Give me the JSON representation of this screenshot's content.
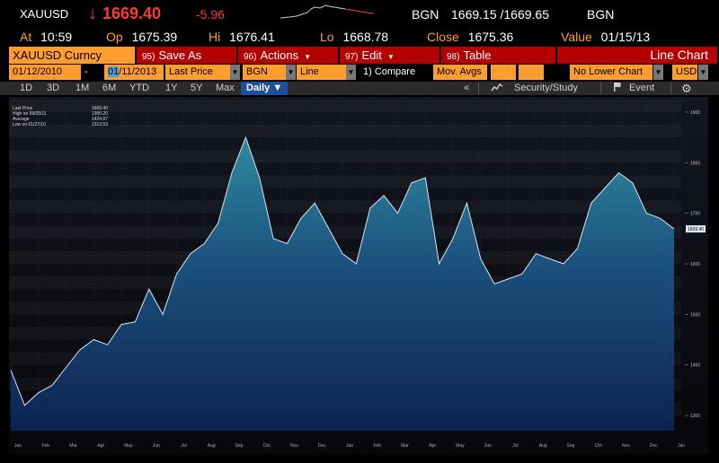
{
  "header": {
    "ticker": "XAUUSD",
    "arrow": "↓",
    "last": "1669.40",
    "change": "-5.96",
    "source": "BGN",
    "bid_ask": "1669.15 /1669.65",
    "source2": "BGN"
  },
  "stats": {
    "at_label": "At",
    "at_value": "10:59",
    "op_label": "Op",
    "op_value": "1675.39",
    "hi_label": "Hi",
    "hi_value": "1676.41",
    "lo_label": "Lo",
    "lo_value": "1668.78",
    "close_label": "Close",
    "close_value": "1675.36",
    "value_label": "Value",
    "value_value": "01/15/13"
  },
  "menu": {
    "security": "XAUUSD Curncy",
    "save_num": "95)",
    "save": "Save As",
    "actions_num": "96)",
    "actions": "Actions",
    "edit_num": "97)",
    "edit": "Edit",
    "table_num": "98)",
    "table": "Table",
    "chart_title": "Line Chart"
  },
  "params": {
    "start_date": "01/12/2010",
    "end_date_sel": "01",
    "end_date_rest": "/11/2013",
    "field": "Last Price",
    "source": "BGN",
    "style": "Line",
    "compare": "1) Compare",
    "mov_avgs": "Mov. Avgs",
    "lower_chart": "No Lower Chart",
    "currency": "USD"
  },
  "toolbar": {
    "periods": [
      "1D",
      "3D",
      "1M",
      "6M",
      "YTD",
      "1Y",
      "5Y",
      "Max"
    ],
    "frequency": "Daily",
    "collapse": "«",
    "security_study": "Security/Study",
    "event": "Event",
    "settings_icon": "gear-icon",
    "chart_icon": "chart-icon",
    "flag_icon": "flag-icon"
  },
  "legend": {
    "rows": [
      {
        "label": "Last Price",
        "value": "1669.40"
      },
      {
        "label": "High on 09/05/11",
        "value": "1900.20"
      },
      {
        "label": "Average",
        "value": "1424.87"
      },
      {
        "label": "Low on 01/27/10",
        "value": "1313.53"
      }
    ]
  },
  "colors": {
    "accent_orange": "#ff9d2e",
    "menu_red": "#b30000",
    "down_red": "#ff3b30",
    "toolbar_active": "#1f4f9a"
  },
  "chart_data": {
    "type": "area",
    "title": "",
    "xlabel": "",
    "ylabel": "",
    "ylim": [
      1270,
      1930
    ],
    "y_ticks": [
      "1900",
      "1800",
      "1700",
      "1600",
      "1500",
      "1400",
      "1300"
    ],
    "last_price_label": "1669.40",
    "x_tick_labels": [
      "Jan",
      "Feb",
      "Mar",
      "Apr",
      "May",
      "Jun",
      "Jul",
      "Aug",
      "Sep",
      "Oct",
      "Nov",
      "Dec",
      "Jan",
      "Feb",
      "Mar",
      "Apr",
      "May",
      "Jun",
      "Jul",
      "Aug",
      "Sep",
      "Oct",
      "Nov",
      "Dec",
      "Jan"
    ],
    "series": [
      {
        "x": [
          0,
          0.5,
          1,
          1.5,
          2,
          2.5,
          3,
          3.5,
          4,
          4.5,
          5,
          5.5,
          6,
          6.5,
          7,
          7.5,
          8,
          8.5,
          9,
          9.5,
          10,
          10.5,
          11,
          11.5,
          12,
          12.5,
          13,
          13.5,
          14,
          14.5,
          15,
          15.5,
          16,
          16.5,
          17,
          17.5,
          18,
          18.5,
          19,
          19.5,
          20,
          20.5,
          21,
          21.5,
          22,
          22.5,
          23,
          23.5,
          24
        ],
        "values": [
          1390,
          1320,
          1345,
          1360,
          1395,
          1430,
          1450,
          1440,
          1480,
          1485,
          1550,
          1500,
          1580,
          1620,
          1640,
          1680,
          1780,
          1850,
          1770,
          1650,
          1640,
          1690,
          1720,
          1670,
          1620,
          1600,
          1710,
          1735,
          1700,
          1760,
          1770,
          1600,
          1650,
          1720,
          1610,
          1560,
          1570,
          1580,
          1620,
          1610,
          1600,
          1630,
          1720,
          1750,
          1780,
          1760,
          1700,
          1690,
          1669
        ]
      }
    ]
  }
}
